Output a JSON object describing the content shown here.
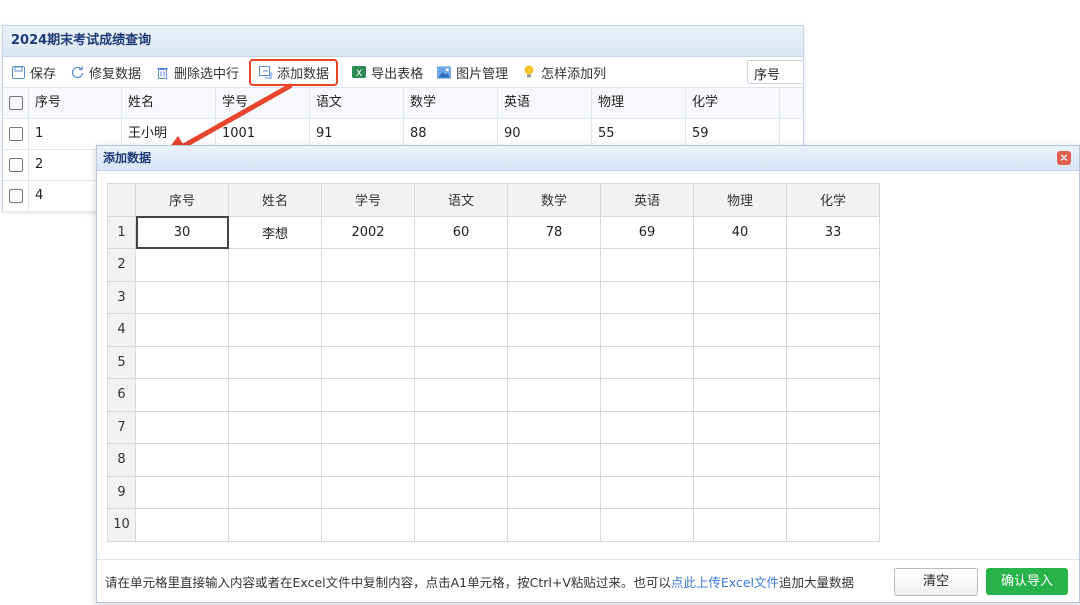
{
  "panel": {
    "title": "2024期末考试成绩查询",
    "toolbar": {
      "save": "保存",
      "restore": "修复数据",
      "delete_row": "删除选中行",
      "add_data": "添加数据",
      "export": "导出表格",
      "images": "图片管理",
      "how_add_col": "怎样添加列"
    },
    "search_value": "序号",
    "columns": [
      "序号",
      "姓名",
      "学号",
      "语文",
      "数学",
      "英语",
      "物理",
      "化学"
    ],
    "rows": [
      [
        "1",
        "王小明",
        "1001",
        "91",
        "88",
        "90",
        "55",
        "59"
      ],
      [
        "2",
        "",
        "",
        "",
        "",
        "",
        "",
        ""
      ],
      [
        "4",
        "",
        "",
        "",
        "",
        "",
        "",
        ""
      ]
    ]
  },
  "dialog": {
    "title": "添加数据",
    "close": "×",
    "columns": [
      "序号",
      "姓名",
      "学号",
      "语文",
      "数学",
      "英语",
      "物理",
      "化学"
    ],
    "row_numbers": [
      "1",
      "2",
      "3",
      "4",
      "5",
      "6",
      "7",
      "8",
      "9",
      "10"
    ],
    "rows": [
      [
        "30",
        "李想",
        "2002",
        "60",
        "78",
        "69",
        "40",
        "33"
      ]
    ],
    "hint_before": "请在单元格里直接输入内容或者在Excel文件中复制内容，点击A1单元格，按Ctrl+V粘贴过来。也可以",
    "hint_link": "点此上传Excel文件",
    "hint_after": "追加大量数据",
    "clear_button": "清空",
    "confirm_button": "确认导入"
  },
  "colors": {
    "accent_red": "#e8452c",
    "confirm_green": "#27b34a",
    "title_blue": "#1f3b73",
    "link_blue": "#3a7bd5"
  },
  "icons": {
    "save": "save-icon",
    "restore": "refresh-icon",
    "delete": "trash-icon",
    "add": "add-data-icon",
    "export": "excel-icon",
    "images": "image-icon",
    "help": "lightbulb-icon",
    "close": "close-icon"
  }
}
